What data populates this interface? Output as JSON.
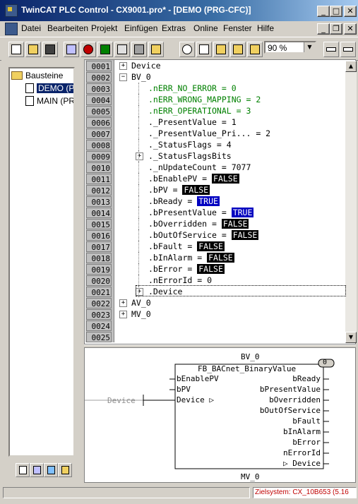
{
  "window": {
    "title": "TwinCAT PLC Control - CX9001.pro* - [DEMO (PRG-CFC)]",
    "controls": {
      "minimize": "_",
      "maximize": "□",
      "close": "✕"
    },
    "mdi_controls": {
      "minimize": "_",
      "restore": "❐",
      "close": "✕"
    }
  },
  "menu": [
    "Datei",
    "Bearbeiten",
    "Projekt",
    "Einfügen",
    "Extras",
    "Online",
    "Fenster",
    "Hilfe"
  ],
  "toolbar": {
    "icons": [
      "new-icon",
      "open-icon",
      "save-icon",
      "compile-icon",
      "stop-icon",
      "run-icon",
      "step-icon",
      "print-icon",
      "login-icon",
      "cut-icon",
      "copy-icon",
      "paste-icon",
      "find-icon",
      "replace-icon"
    ],
    "zoom": "90 %"
  },
  "tree": {
    "root": "Bausteine",
    "items": [
      "DEMO (PR",
      "MAIN (PR"
    ]
  },
  "editor": {
    "line_numbers": [
      "0001",
      "0002",
      "0003",
      "0004",
      "0005",
      "0006",
      "0007",
      "0008",
      "0009",
      "0010",
      "0011",
      "0012",
      "0013",
      "0014",
      "0015",
      "0016",
      "0017",
      "0018",
      "0019",
      "0020",
      "0021",
      "0022",
      "0023",
      "0024",
      "0025"
    ],
    "lines": [
      {
        "text": "Device",
        "expander": "+"
      },
      {
        "text": "BV_0",
        "expander": "−"
      },
      {
        "text": ".nERR_NO_ERROR = 0",
        "green": true
      },
      {
        "text": ".nERR_WRONG_MAPPING = 2",
        "green": true
      },
      {
        "text": ".nERR_OPERATIONAL = 3",
        "green": true
      },
      {
        "text": "._PresentValue = 1"
      },
      {
        "text": "._PresentValue_Pri... = 2"
      },
      {
        "text": "._StatusFlags = 4"
      },
      {
        "text": "._StatusFlagsBits",
        "expander": "+"
      },
      {
        "text": "._nUpdateCount = 7077"
      },
      {
        "text": ".bEnablePV = ",
        "value": "FALSE"
      },
      {
        "text": ".bPV = ",
        "value": "FALSE"
      },
      {
        "text": ".bReady = ",
        "value": "TRUE"
      },
      {
        "text": ".bPresentValue = ",
        "value": "TRUE"
      },
      {
        "text": ".bOverridden = ",
        "value": "FALSE"
      },
      {
        "text": ".bOutOfService = ",
        "value": "FALSE"
      },
      {
        "text": ".bFault = ",
        "value": "FALSE"
      },
      {
        "text": ".bInAlarm = ",
        "value": "FALSE"
      },
      {
        "text": ".bError = ",
        "value": "FALSE"
      },
      {
        "text": ".nErrorId = 0"
      },
      {
        "text": ".Device",
        "expander": "+"
      },
      {
        "text": "AV_0",
        "expander": "+"
      },
      {
        "text": "MV_0",
        "expander": "+"
      }
    ]
  },
  "cfc": {
    "instance": "BV_0",
    "type": "FB_BACnet_BinaryValue",
    "order": "0",
    "input_box": "Device",
    "inputs": [
      "bEnablePV",
      "bPV",
      "Device ▷"
    ],
    "outputs": [
      "bReady",
      "bPresentValue",
      "bOverridden",
      "bOutOfService",
      "bFault",
      "bInAlarm",
      "bError",
      "nErrorId",
      "▷ Device"
    ],
    "next_instance": "MV_0"
  },
  "status": {
    "target": "Zielsystem: CX_10B653 (5.16"
  }
}
